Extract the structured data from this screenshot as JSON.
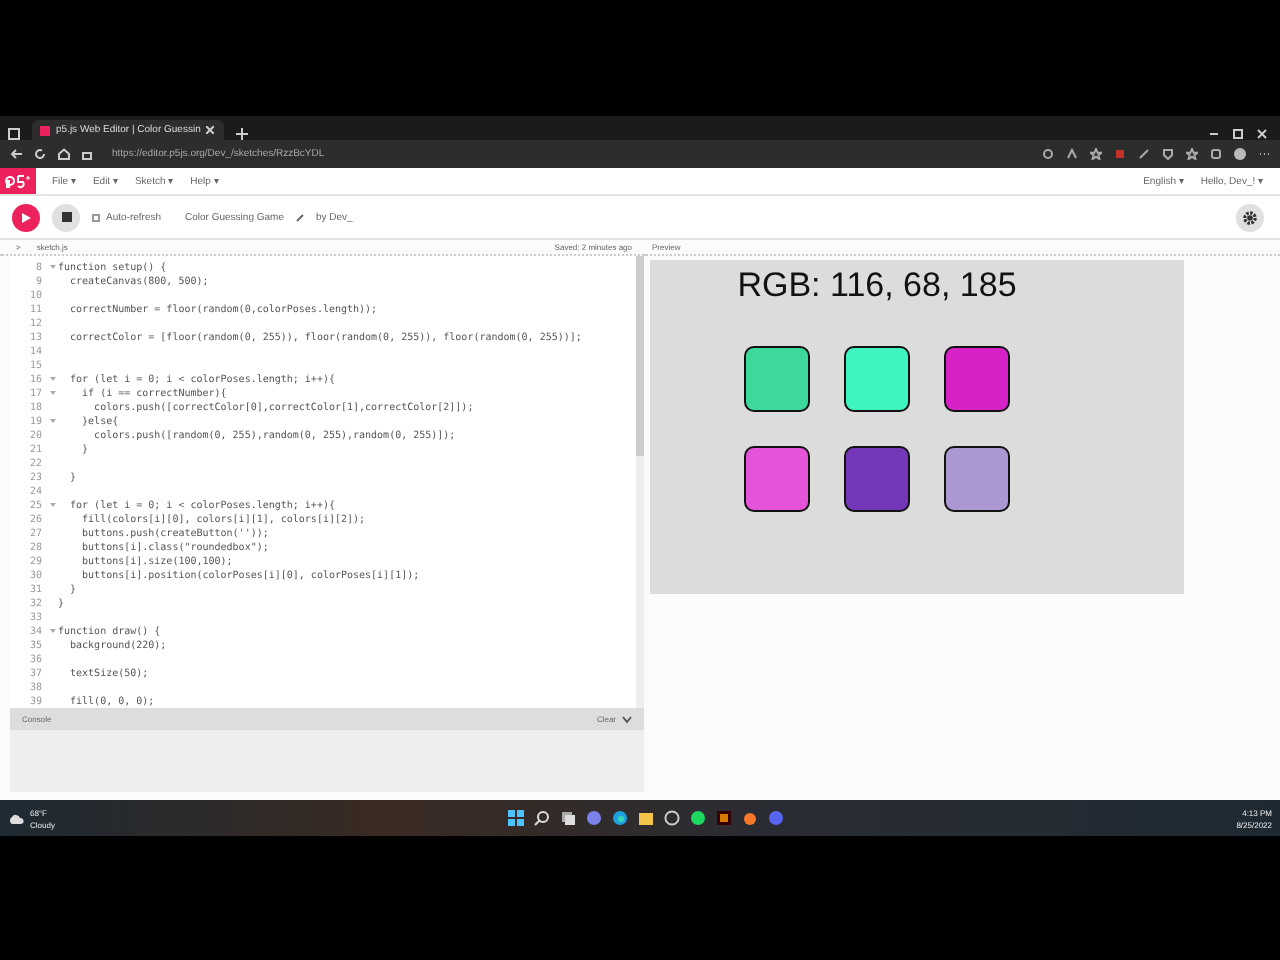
{
  "browser": {
    "tab_title": "p5.js Web Editor | Color Guessin",
    "url": "https://editor.p5js.org/Dev_/sketches/RzzBcYDL"
  },
  "menu": {
    "items": [
      "File ▾",
      "Edit ▾",
      "Sketch ▾",
      "Help ▾"
    ],
    "language": "English ▾",
    "user": "Hello, Dev_! ▾"
  },
  "toolbar": {
    "auto_refresh": {
      "label": "Auto-refresh",
      "checked": false
    },
    "sketch_name": "Color Guessing Game",
    "author": "by Dev_"
  },
  "editor": {
    "file": "sketch.js",
    "toggle": ">",
    "saved": "Saved: 2 minutes ago",
    "lines": [
      {
        "number": "8",
        "fold": true,
        "text": "function setup() {"
      },
      {
        "number": "9",
        "fold": false,
        "text": "  createCanvas(800, 500);"
      },
      {
        "number": "10",
        "fold": false
      },
      {
        "number": "11",
        "fold": false,
        "text": "  correctNumber = floor(random(0,colorPoses.length));"
      },
      {
        "number": "12",
        "fold": false
      },
      {
        "number": "13",
        "fold": false,
        "text": "  correctColor = [floor(random(0, 255)), floor(random(0, 255)), floor(random(0, 255))];"
      },
      {
        "number": "14",
        "fold": false
      },
      {
        "number": "15",
        "fold": false
      },
      {
        "number": "16",
        "fold": true,
        "text": "  for (let i = 0; i < colorPoses.length; i++){"
      },
      {
        "number": "17",
        "fold": true,
        "text": "    if (i == correctNumber){"
      },
      {
        "number": "18",
        "fold": false,
        "text": "      colors.push([correctColor[0],correctColor[1],correctColor[2]]);"
      },
      {
        "number": "19",
        "fold": true,
        "text": "    }else{"
      },
      {
        "number": "20",
        "fold": false,
        "text": "      colors.push([random(0, 255),random(0, 255),random(0, 255)]);"
      },
      {
        "number": "21",
        "fold": false,
        "text": "    }"
      },
      {
        "number": "22",
        "fold": false
      },
      {
        "number": "23",
        "fold": false,
        "text": "  }"
      },
      {
        "number": "24",
        "fold": false
      },
      {
        "number": "25",
        "fold": true,
        "text": "  for (let i = 0; i < colorPoses.length; i++){"
      },
      {
        "number": "26",
        "fold": false,
        "text": "    fill(colors[i][0], colors[i][1], colors[i][2]);"
      },
      {
        "number": "27",
        "fold": false,
        "text": "    buttons.push(createButton(''));"
      },
      {
        "number": "28",
        "fold": false,
        "text": "    buttons[i].class(\"roundedbox\");"
      },
      {
        "number": "29",
        "fold": false,
        "text": "    buttons[i].size(100,100);"
      },
      {
        "number": "30",
        "fold": false,
        "text": "    buttons[i].position(colorPoses[i][0], colorPoses[i][1]);"
      },
      {
        "number": "31",
        "fold": false,
        "text": "  }"
      },
      {
        "number": "32",
        "fold": false,
        "text": "}"
      },
      {
        "number": "33",
        "fold": false
      },
      {
        "number": "34",
        "fold": true,
        "text": "function draw() {"
      },
      {
        "number": "35",
        "fold": false,
        "text": "  background(220);"
      },
      {
        "number": "36",
        "fold": false
      },
      {
        "number": "37",
        "fold": false,
        "text": "  textSize(50);"
      },
      {
        "number": "38",
        "fold": false
      },
      {
        "number": "39",
        "fold": false,
        "text": "  fill(0, 0, 0);"
      }
    ]
  },
  "console": {
    "label": "Console",
    "clear": "Clear"
  },
  "preview": {
    "label": "Preview",
    "heading": "RGB: 116, 68, 185",
    "swatches": [
      {
        "color": "#3dd99a"
      },
      {
        "color": "#3ef5c0"
      },
      {
        "color": "#d622c6"
      },
      {
        "color": "#e453d8"
      },
      {
        "color": "#7437b9"
      },
      {
        "color": "#ab97d2"
      }
    ]
  },
  "taskbar": {
    "temperature": "68°F",
    "weather": "Cloudy",
    "time": "4:13 PM",
    "date": "8/25/2022"
  }
}
